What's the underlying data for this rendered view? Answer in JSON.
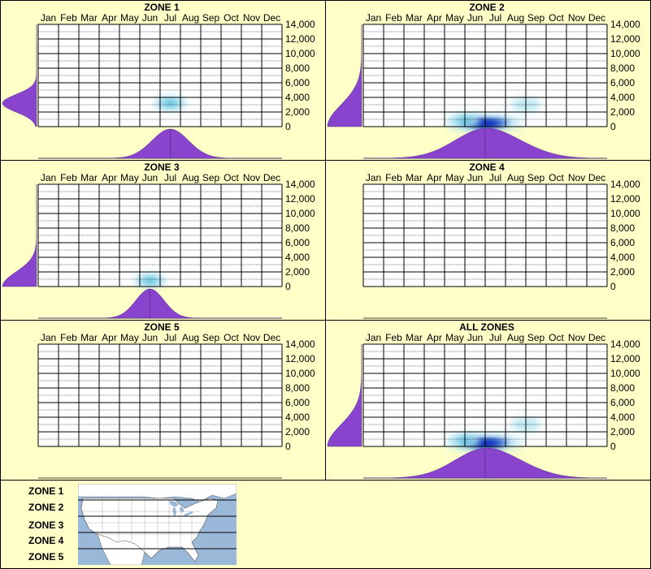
{
  "months": [
    "Jan",
    "Feb",
    "Mar",
    "Apr",
    "May",
    "Jun",
    "Jul",
    "Aug",
    "Sep",
    "Oct",
    "Nov",
    "Dec"
  ],
  "y_ticks": [
    "14,000",
    "12,000",
    "10,000",
    "8,000",
    "6,000",
    "4,000",
    "2,000",
    "0"
  ],
  "y_tick_values": [
    14000,
    12000,
    10000,
    8000,
    6000,
    4000,
    2000,
    0
  ],
  "colors": {
    "background": "#ffffc8",
    "distribution": "#8844cc",
    "heat_light": "#a8e0ee",
    "heat_dark": "#0018b0",
    "map_water": "#9ab8d8",
    "map_land": "#ffffff"
  },
  "chart_data": [
    {
      "type": "heatmap",
      "title": "ZONE 1",
      "x_axis": "month",
      "y_axis": "elevation",
      "ylim": [
        0,
        14000
      ],
      "hotspots": [
        {
          "month": 7,
          "elevation": 3200,
          "intensity": 0.45
        }
      ],
      "month_distribution": {
        "peak_month": 7,
        "spread": 0.9
      },
      "elevation_distribution": {
        "peak_elevation": 3200,
        "spread": 1200
      }
    },
    {
      "type": "heatmap",
      "title": "ZONE 2",
      "x_axis": "month",
      "y_axis": "elevation",
      "ylim": [
        0,
        14000
      ],
      "hotspots": [
        {
          "month": 6.5,
          "elevation": 500,
          "intensity": 1.0
        },
        {
          "month": 5.5,
          "elevation": 800,
          "intensity": 0.35
        },
        {
          "month": 8.5,
          "elevation": 3000,
          "intensity": 0.2
        }
      ],
      "month_distribution": {
        "peak_month": 6.5,
        "spread": 1.5
      },
      "elevation_distribution": {
        "peak_elevation": 0,
        "spread": 3000
      }
    },
    {
      "type": "heatmap",
      "title": "ZONE 3",
      "x_axis": "month",
      "y_axis": "elevation",
      "ylim": [
        0,
        14000
      ],
      "hotspots": [
        {
          "month": 6,
          "elevation": 800,
          "intensity": 0.4
        }
      ],
      "month_distribution": {
        "peak_month": 6,
        "spread": 0.7
      },
      "elevation_distribution": {
        "peak_elevation": 0,
        "spread": 2000
      }
    },
    {
      "type": "heatmap",
      "title": "ZONE 4",
      "x_axis": "month",
      "y_axis": "elevation",
      "ylim": [
        0,
        14000
      ],
      "hotspots": []
    },
    {
      "type": "heatmap",
      "title": "ZONE 5",
      "x_axis": "month",
      "y_axis": "elevation",
      "ylim": [
        0,
        14000
      ],
      "hotspots": []
    },
    {
      "type": "heatmap",
      "title": "ALL ZONES",
      "x_axis": "month",
      "y_axis": "elevation",
      "ylim": [
        0,
        14000
      ],
      "hotspots": [
        {
          "month": 6.5,
          "elevation": 500,
          "intensity": 1.0
        },
        {
          "month": 5.5,
          "elevation": 800,
          "intensity": 0.35
        },
        {
          "month": 8.5,
          "elevation": 3000,
          "intensity": 0.2
        }
      ],
      "month_distribution": {
        "peak_month": 6.5,
        "spread": 1.5
      },
      "elevation_distribution": {
        "peak_elevation": 0,
        "spread": 3000
      }
    }
  ],
  "legend": {
    "zones": [
      "ZONE 1",
      "ZONE 2",
      "ZONE 3",
      "ZONE 4",
      "ZONE 5"
    ],
    "map": "us-zones-map"
  }
}
